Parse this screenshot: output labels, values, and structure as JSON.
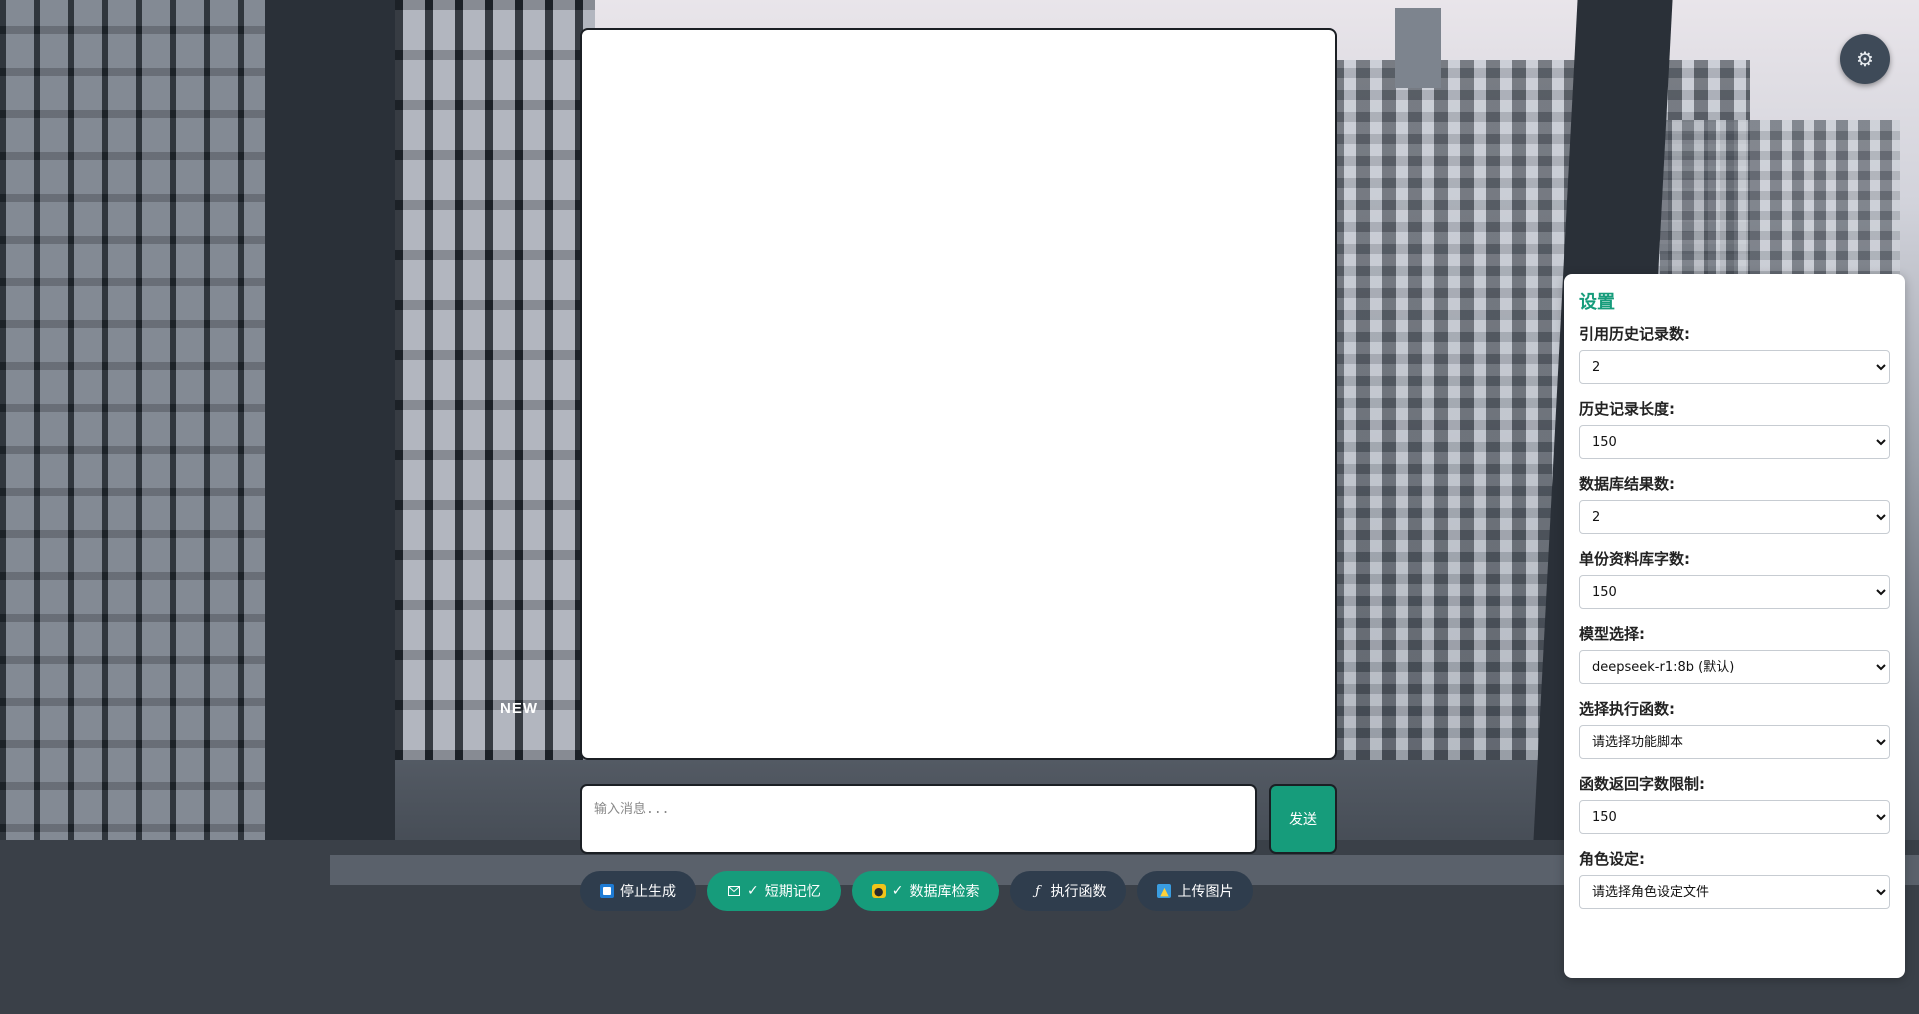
{
  "chat": {
    "input_placeholder": "输入消息...",
    "send_label": "发送"
  },
  "toolbar": {
    "stop_label": "停止生成",
    "short_memory_label": "短期记忆",
    "db_search_label": "数据库检索",
    "exec_func_label": "执行函数",
    "upload_image_label": "上传图片",
    "check_mark": "✓",
    "active_color": "#169c7b",
    "inactive_color": "#2f3d4d"
  },
  "settings": {
    "title": "设置",
    "fields": [
      {
        "label": "引用历史记录数:",
        "value": "2"
      },
      {
        "label": "历史记录长度:",
        "value": "150"
      },
      {
        "label": "数据库结果数:",
        "value": "2"
      },
      {
        "label": "单份资料库字数:",
        "value": "150"
      },
      {
        "label": "模型选择:",
        "value": "deepseek-r1:8b (默认)"
      },
      {
        "label": "选择执行函数:",
        "value": "请选择功能脚本"
      },
      {
        "label": "函数返回字数限制:",
        "value": "150"
      },
      {
        "label": "角色设定:",
        "value": "请选择角色设定文件"
      }
    ]
  },
  "icons": {
    "gear": "gear-icon",
    "stop": "stop-icon",
    "mail": "envelope-icon",
    "database": "database-icon",
    "function": "function-icon",
    "image": "image-icon"
  },
  "background": {
    "logo_text": "NEW"
  }
}
